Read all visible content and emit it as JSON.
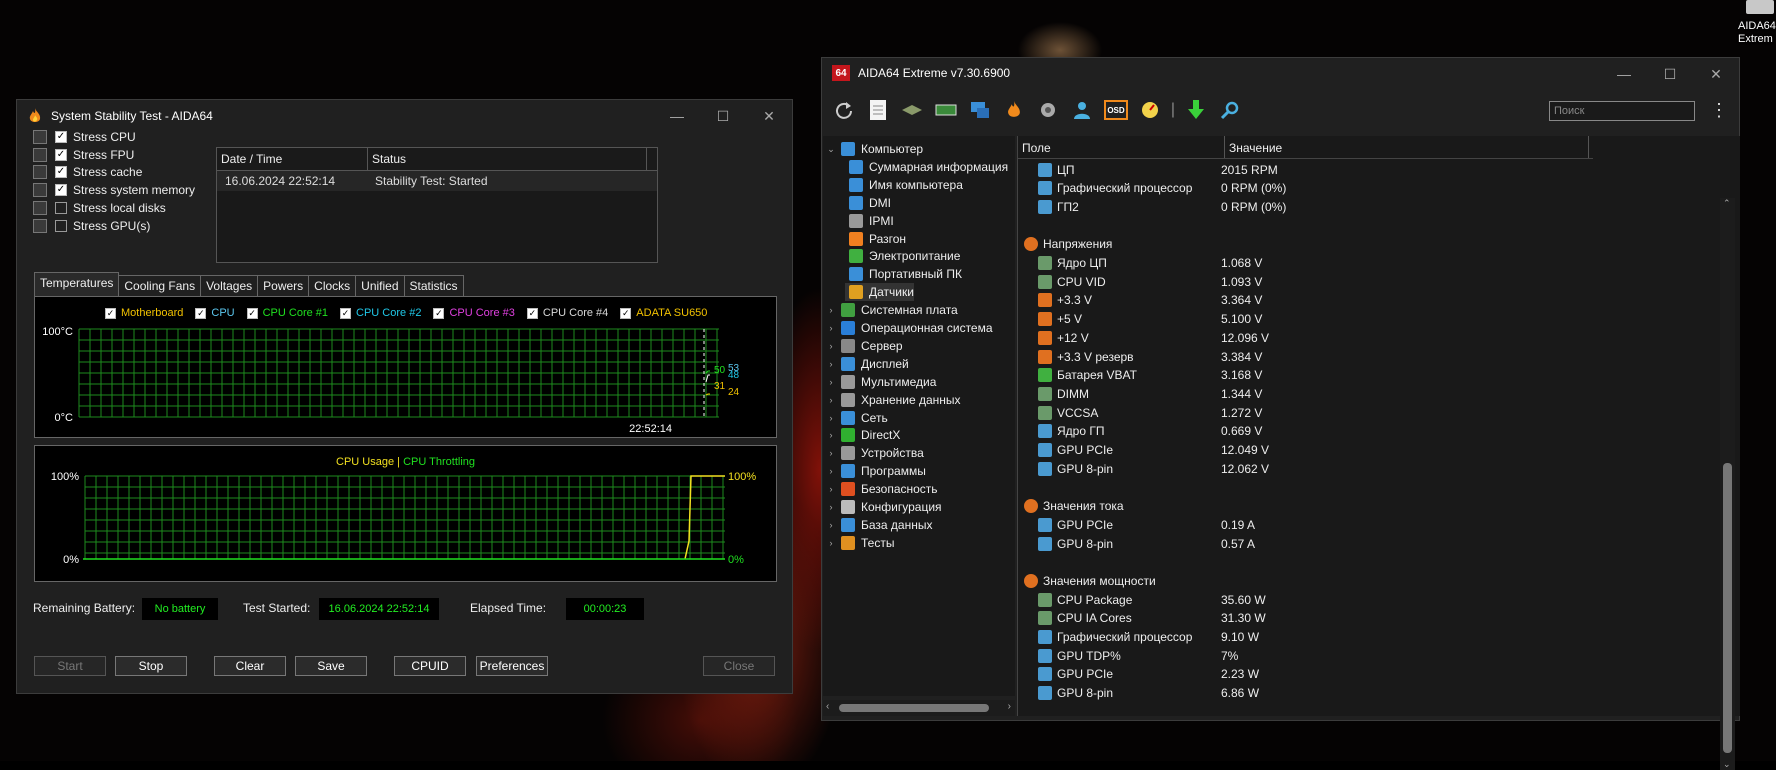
{
  "desktop": {
    "icon_label_1": "AIDA64",
    "icon_label_2": "Extrem"
  },
  "stability": {
    "title": "System Stability Test - AIDA64",
    "stress_items": [
      {
        "label": "Stress CPU",
        "checked": true
      },
      {
        "label": "Stress FPU",
        "checked": true
      },
      {
        "label": "Stress cache",
        "checked": true
      },
      {
        "label": "Stress system memory",
        "checked": true
      },
      {
        "label": "Stress local disks",
        "checked": false
      },
      {
        "label": "Stress GPU(s)",
        "checked": false
      }
    ],
    "log": {
      "headers": [
        "Date / Time",
        "Status"
      ],
      "rows": [
        {
          "time": "16.06.2024 22:52:14",
          "status": "Stability Test: Started"
        }
      ]
    },
    "tabs": [
      "Temperatures",
      "Cooling Fans",
      "Voltages",
      "Powers",
      "Clocks",
      "Unified",
      "Statistics"
    ],
    "temp_legend": [
      {
        "label": "Motherboard",
        "color": "#f2c200"
      },
      {
        "label": "CPU",
        "color": "#5cc8f0"
      },
      {
        "label": "CPU Core #1",
        "color": "#20e020"
      },
      {
        "label": "CPU Core #2",
        "color": "#20c8e8"
      },
      {
        "label": "CPU Core #3",
        "color": "#e040e0"
      },
      {
        "label": "CPU Core #4",
        "color": "#d8d8d8"
      },
      {
        "label": "ADATA SU650",
        "color": "#f2c200"
      }
    ],
    "temp_axis": {
      "top": "100°C",
      "bottom": "0°C",
      "time": "22:52:14"
    },
    "temp_values": {
      "v50": "50",
      "v53": "53",
      "v48": "48",
      "v31": "31",
      "v24": "24"
    },
    "usage_title": {
      "a": "CPU Usage",
      "sep": "|",
      "b": "CPU Throttling"
    },
    "usage_axis": {
      "top": "100%",
      "bottom": "0%",
      "right_top": "100%",
      "right_bottom": "0%"
    },
    "remaining_battery_label": "Remaining Battery:",
    "remaining_battery_value": "No battery",
    "test_started_label": "Test Started:",
    "test_started_value": "16.06.2024 22:52:14",
    "elapsed_label": "Elapsed Time:",
    "elapsed_value": "00:00:23",
    "buttons": {
      "start": "Start",
      "stop": "Stop",
      "clear": "Clear",
      "save": "Save",
      "cpuid": "CPUID",
      "preferences": "Preferences",
      "close": "Close"
    }
  },
  "aida": {
    "title": "AIDA64 Extreme v7.30.6900",
    "app_icon": "64",
    "toolbar_osd": "OSD",
    "search_placeholder": "Поиск",
    "tree": [
      {
        "label": "Компьютер",
        "level": 0,
        "expanded": true,
        "color": "#3a8fd8"
      },
      {
        "label": "Суммарная информация",
        "level": 1,
        "color": "#3a8fd8"
      },
      {
        "label": "Имя компьютера",
        "level": 1,
        "color": "#3a8fd8"
      },
      {
        "label": "DMI",
        "level": 1,
        "color": "#3a8fd8"
      },
      {
        "label": "IPMI",
        "level": 1,
        "color": "#999"
      },
      {
        "label": "Разгон",
        "level": 1,
        "color": "#f08020"
      },
      {
        "label": "Электропитание",
        "level": 1,
        "color": "#40b040"
      },
      {
        "label": "Портативный ПК",
        "level": 1,
        "color": "#3a8fd8"
      },
      {
        "label": "Датчики",
        "level": 1,
        "color": "#e0a020",
        "selected": true
      },
      {
        "label": "Системная плата",
        "level": 0,
        "color": "#40a040"
      },
      {
        "label": "Операционная система",
        "level": 0,
        "color": "#2a7fd8"
      },
      {
        "label": "Сервер",
        "level": 0,
        "color": "#888"
      },
      {
        "label": "Дисплей",
        "level": 0,
        "color": "#3a8fd8"
      },
      {
        "label": "Мультимедиа",
        "level": 0,
        "color": "#999"
      },
      {
        "label": "Хранение данных",
        "level": 0,
        "color": "#999"
      },
      {
        "label": "Сеть",
        "level": 0,
        "color": "#3a8fd8"
      },
      {
        "label": "DirectX",
        "level": 0,
        "color": "#30b030"
      },
      {
        "label": "Устройства",
        "level": 0,
        "color": "#999"
      },
      {
        "label": "Программы",
        "level": 0,
        "color": "#3a8fd8"
      },
      {
        "label": "Безопасность",
        "level": 0,
        "color": "#e05020"
      },
      {
        "label": "Конфигурация",
        "level": 0,
        "color": "#bbb"
      },
      {
        "label": "База данных",
        "level": 0,
        "color": "#3a8fd8"
      },
      {
        "label": "Тесты",
        "level": 0,
        "color": "#e09020"
      }
    ],
    "list_headers": [
      "Поле",
      "Значение"
    ],
    "rows": [
      {
        "type": "item",
        "label": "ЦП",
        "value": "2015 RPM",
        "color": "#4a9ad0"
      },
      {
        "type": "item",
        "label": "Графический процессор",
        "value": "0 RPM  (0%)",
        "color": "#4a9ad0"
      },
      {
        "type": "item",
        "label": "ГП2",
        "value": "0 RPM  (0%)",
        "color": "#4a9ad0"
      },
      {
        "type": "gap"
      },
      {
        "type": "group",
        "label": "Напряжения",
        "color": "#e07020"
      },
      {
        "type": "item",
        "label": "Ядро ЦП",
        "value": "1.068 V",
        "color": "#6a9a6a"
      },
      {
        "type": "item",
        "label": "CPU VID",
        "value": "1.093 V",
        "color": "#6a9a6a"
      },
      {
        "type": "item",
        "label": "+3.3 V",
        "value": "3.364 V",
        "color": "#e07020"
      },
      {
        "type": "item",
        "label": "+5 V",
        "value": "5.100 V",
        "color": "#e07020"
      },
      {
        "type": "item",
        "label": "+12 V",
        "value": "12.096 V",
        "color": "#e07020"
      },
      {
        "type": "item",
        "label": "+3.3 V резерв",
        "value": "3.384 V",
        "color": "#e07020"
      },
      {
        "type": "item",
        "label": "Батарея VBAT",
        "value": "3.168 V",
        "color": "#40b040"
      },
      {
        "type": "item",
        "label": "DIMM",
        "value": "1.344 V",
        "color": "#6a9a6a"
      },
      {
        "type": "item",
        "label": "VCCSA",
        "value": "1.272 V",
        "color": "#6a9a6a"
      },
      {
        "type": "item",
        "label": "Ядро ГП",
        "value": "0.669 V",
        "color": "#4a9ad0"
      },
      {
        "type": "item",
        "label": "GPU PCIe",
        "value": "12.049 V",
        "color": "#4a9ad0"
      },
      {
        "type": "item",
        "label": "GPU 8-pin",
        "value": "12.062 V",
        "color": "#4a9ad0"
      },
      {
        "type": "gap"
      },
      {
        "type": "group",
        "label": "Значения тока",
        "color": "#e07020"
      },
      {
        "type": "item",
        "label": "GPU PCIe",
        "value": "0.19 A",
        "color": "#4a9ad0"
      },
      {
        "type": "item",
        "label": "GPU 8-pin",
        "value": "0.57 A",
        "color": "#4a9ad0"
      },
      {
        "type": "gap"
      },
      {
        "type": "group",
        "label": "Значения мощности",
        "color": "#e07020"
      },
      {
        "type": "item",
        "label": "CPU Package",
        "value": "35.60 W",
        "color": "#6a9a6a"
      },
      {
        "type": "item",
        "label": "CPU IA Cores",
        "value": "31.30 W",
        "color": "#6a9a6a"
      },
      {
        "type": "item",
        "label": "Графический процессор",
        "value": "9.10 W",
        "color": "#4a9ad0"
      },
      {
        "type": "item",
        "label": "GPU TDP%",
        "value": "7%",
        "color": "#4a9ad0"
      },
      {
        "type": "item",
        "label": "GPU PCIe",
        "value": "2.23 W",
        "color": "#4a9ad0"
      },
      {
        "type": "item",
        "label": "GPU 8-pin",
        "value": "6.86 W",
        "color": "#4a9ad0"
      }
    ]
  }
}
